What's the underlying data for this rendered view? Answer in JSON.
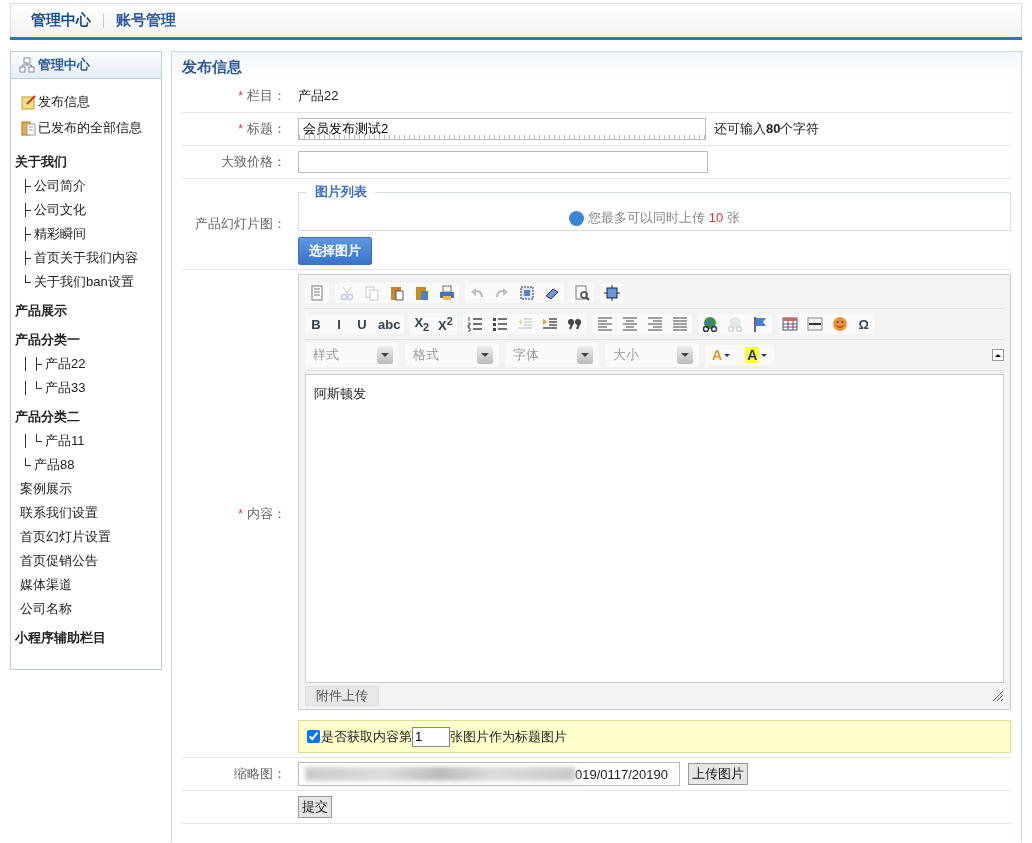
{
  "header": {
    "tabs": [
      {
        "label": "管理中心",
        "selected": true
      },
      {
        "label": "账号管理",
        "selected": false
      }
    ]
  },
  "sidebar": {
    "title": "管理中心",
    "links": [
      {
        "kind": "edit",
        "label": "发布信息"
      },
      {
        "kind": "folder",
        "label": "已发布的全部信息"
      }
    ],
    "tree": [
      {
        "kind": "heading",
        "label": "关于我们",
        "children": [
          {
            "label": "公司简介"
          },
          {
            "label": "公司文化"
          },
          {
            "label": "精彩瞬间"
          },
          {
            "label": "首页关于我们内容"
          },
          {
            "label": "关于我们ban设置"
          }
        ]
      },
      {
        "kind": "heading",
        "label": "产品展示"
      },
      {
        "kind": "heading",
        "label": "产品分类一",
        "children": [
          {
            "label": "产品22"
          },
          {
            "label": "产品33"
          }
        ],
        "nested": true
      },
      {
        "kind": "heading",
        "label": "产品分类二",
        "children": [
          {
            "label": "产品11"
          }
        ],
        "nested": true,
        "tail": {
          "label": "产品88"
        }
      },
      {
        "kind": "link",
        "label": "案例展示"
      },
      {
        "kind": "link",
        "label": "联系我们设置"
      },
      {
        "kind": "link",
        "label": "首页幻灯片设置"
      },
      {
        "kind": "link",
        "label": "首页促销公告"
      },
      {
        "kind": "link",
        "label": "媒体渠道"
      },
      {
        "kind": "link",
        "label": "公司名称"
      },
      {
        "kind": "heading",
        "label": "小程序辅助栏目"
      }
    ]
  },
  "form": {
    "title": "发布信息",
    "column": {
      "label": "栏目：",
      "required_mark": "*",
      "value": "产品22"
    },
    "headline": {
      "label": "标题：",
      "required_mark": "*",
      "value": "会员发布测试2",
      "counter": "还可输入**80**个字符"
    },
    "price": {
      "label": "大致价格："
    },
    "slides": {
      "label": "产品幻灯片图：",
      "legend": "图片列表",
      "notice_before": "您最多可以同时上传",
      "notice_count": "10",
      "notice_after": "张",
      "button": "选择图片"
    },
    "content": {
      "label": "内容：",
      "required_mark": "*",
      "toolbar": [
        [
          [
            {
              "kind": "source",
              "disabled": false
            }
          ],
          [
            {
              "kind": "cut",
              "disabled": true
            },
            {
              "kind": "copy",
              "disabled": true
            },
            {
              "kind": "paste",
              "disabled": false
            },
            {
              "kind": "pasteword",
              "disabled": false
            },
            {
              "kind": "print",
              "disabled": false
            }
          ],
          [
            {
              "kind": "undo",
              "disabled": true
            },
            {
              "kind": "redo",
              "disabled": true
            },
            {
              "kind": "selectall",
              "disabled": false
            },
            {
              "kind": "eraser",
              "disabled": false
            }
          ],
          [
            {
              "kind": "preview",
              "disabled": false
            }
          ],
          [
            {
              "kind": "maximize",
              "disabled": false
            }
          ]
        ],
        [
          [
            {
              "kind": "glyph",
              "label": "B",
              "disabled": false
            },
            {
              "kind": "glyph",
              "label": "I",
              "disabled": false
            },
            {
              "kind": "glyph",
              "label": "U",
              "disabled": false
            },
            {
              "kind": "glyph",
              "label": "abc",
              "disabled": false
            }
          ],
          [
            {
              "kind": "glyph",
              "label": "X$_{2}$",
              "disabled": false
            },
            {
              "kind": "glyph",
              "label": "X$^{2}$",
              "disabled": false
            }
          ],
          [
            {
              "kind": "olist",
              "disabled": false
            },
            {
              "kind": "ulist",
              "disabled": false
            },
            {
              "kind": "outdent",
              "disabled": true
            },
            {
              "kind": "indent",
              "disabled": false
            },
            {
              "kind": "quote",
              "disabled": false
            }
          ],
          [
            {
              "kind": "alignleft",
              "disabled": false
            },
            {
              "kind": "aligncenter",
              "disabled": false
            },
            {
              "kind": "alignright",
              "disabled": false
            },
            {
              "kind": "justify",
              "disabled": false
            }
          ],
          [
            {
              "kind": "link",
              "disabled": false
            },
            {
              "kind": "unlink",
              "disabled": true
            },
            {
              "kind": "anchor",
              "disabled": false
            }
          ],
          [
            {
              "kind": "table",
              "disabled": false
            },
            {
              "kind": "hr",
              "disabled": false
            },
            {
              "kind": "smiley",
              "disabled": false
            },
            {
              "kind": "glyph",
              "label": "Ω",
              "disabled": false
            }
          ]
        ]
      ],
      "combos": [
        "样式",
        "格式",
        "字体",
        "大小"
      ],
      "colors": [
        {
          "label": "A",
          "kind": "textcolor"
        },
        {
          "label": "A",
          "kind": "bgcolor"
        }
      ],
      "body": "阿斯顿发",
      "attach_button": "附件上传",
      "use_image": {
        "checked": true,
        "before": "是否获取内容第",
        "number": "1",
        "after": "张图片作为标题图片"
      }
    },
    "thumbnail": {
      "label": "缩略图：",
      "value": "019/0117/20190",
      "button": "上传图片"
    },
    "submit": "提交"
  }
}
